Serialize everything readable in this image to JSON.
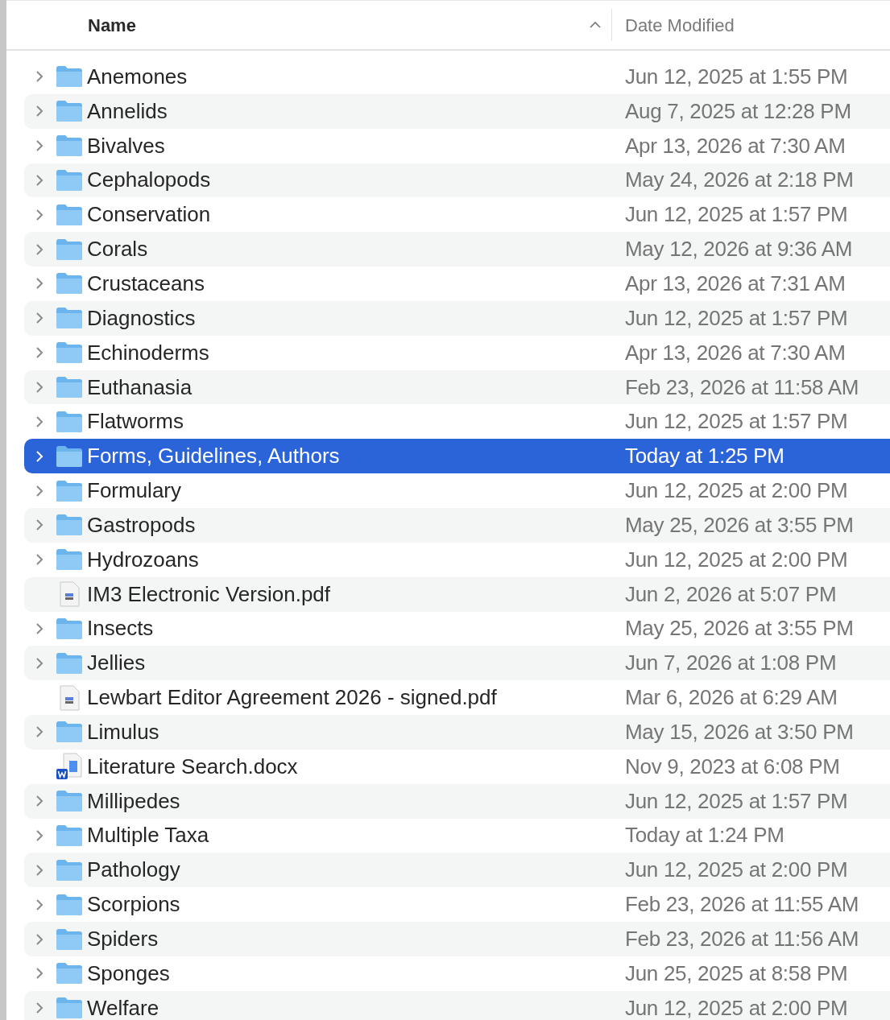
{
  "columns": [
    {
      "label": "Name",
      "sort_ascending": true
    },
    {
      "label": "Date Modified"
    }
  ],
  "rows": [
    {
      "kind": "folder",
      "name": "Anemones",
      "date": "Jun 12, 2025 at 1:55 PM",
      "selected": false
    },
    {
      "kind": "folder",
      "name": "Annelids",
      "date": "Aug 7, 2025 at 12:28 PM",
      "selected": false
    },
    {
      "kind": "folder",
      "name": "Bivalves",
      "date": "Apr 13, 2026 at 7:30 AM",
      "selected": false
    },
    {
      "kind": "folder",
      "name": "Cephalopods",
      "date": "May 24, 2026 at 2:18 PM",
      "selected": false
    },
    {
      "kind": "folder",
      "name": "Conservation",
      "date": "Jun 12, 2025 at 1:57 PM",
      "selected": false
    },
    {
      "kind": "folder",
      "name": "Corals",
      "date": "May 12, 2026 at 9:36 AM",
      "selected": false
    },
    {
      "kind": "folder",
      "name": "Crustaceans",
      "date": "Apr 13, 2026 at 7:31 AM",
      "selected": false
    },
    {
      "kind": "folder",
      "name": "Diagnostics",
      "date": "Jun 12, 2025 at 1:57 PM",
      "selected": false
    },
    {
      "kind": "folder",
      "name": "Echinoderms",
      "date": "Apr 13, 2026 at 7:30 AM",
      "selected": false
    },
    {
      "kind": "folder",
      "name": "Euthanasia",
      "date": "Feb 23, 2026 at 11:58 AM",
      "selected": false
    },
    {
      "kind": "folder",
      "name": "Flatworms",
      "date": "Jun 12, 2025 at 1:57 PM",
      "selected": false
    },
    {
      "kind": "folder",
      "name": "Forms, Guidelines, Authors",
      "date": "Today at 1:25 PM",
      "selected": true
    },
    {
      "kind": "folder",
      "name": "Formulary",
      "date": "Jun 12, 2025 at 2:00 PM",
      "selected": false
    },
    {
      "kind": "folder",
      "name": "Gastropods",
      "date": "May 25, 2026 at 3:55 PM",
      "selected": false
    },
    {
      "kind": "folder",
      "name": "Hydrozoans",
      "date": "Jun 12, 2025 at 2:00 PM",
      "selected": false
    },
    {
      "kind": "pdf",
      "name": "IM3 Electronic Version.pdf",
      "date": "Jun 2, 2026 at 5:07 PM",
      "selected": false
    },
    {
      "kind": "folder",
      "name": "Insects",
      "date": "May 25, 2026 at 3:55 PM",
      "selected": false
    },
    {
      "kind": "folder",
      "name": "Jellies",
      "date": "Jun 7, 2026 at 1:08 PM",
      "selected": false
    },
    {
      "kind": "pdf",
      "name": "Lewbart Editor Agreement 2026 - signed.pdf",
      "date": "Mar 6, 2026 at 6:29 AM",
      "selected": false
    },
    {
      "kind": "folder",
      "name": "Limulus",
      "date": "May 15, 2026 at 3:50 PM",
      "selected": false
    },
    {
      "kind": "docx",
      "name": "Literature Search.docx",
      "date": "Nov 9, 2023 at 6:08 PM",
      "selected": false
    },
    {
      "kind": "folder",
      "name": "Millipedes",
      "date": "Jun 12, 2025 at 1:57 PM",
      "selected": false
    },
    {
      "kind": "folder",
      "name": "Multiple Taxa",
      "date": "Today at 1:24 PM",
      "selected": false
    },
    {
      "kind": "folder",
      "name": "Pathology",
      "date": "Jun 12, 2025 at 2:00 PM",
      "selected": false
    },
    {
      "kind": "folder",
      "name": "Scorpions",
      "date": "Feb 23, 2026 at 11:55 AM",
      "selected": false
    },
    {
      "kind": "folder",
      "name": "Spiders",
      "date": "Feb 23, 2026 at 11:56 AM",
      "selected": false
    },
    {
      "kind": "folder",
      "name": "Sponges",
      "date": "Jun 25, 2025 at 8:58 PM",
      "selected": false
    },
    {
      "kind": "folder",
      "name": "Welfare",
      "date": "Jun 12, 2025 at 2:00 PM",
      "selected": false
    }
  ]
}
